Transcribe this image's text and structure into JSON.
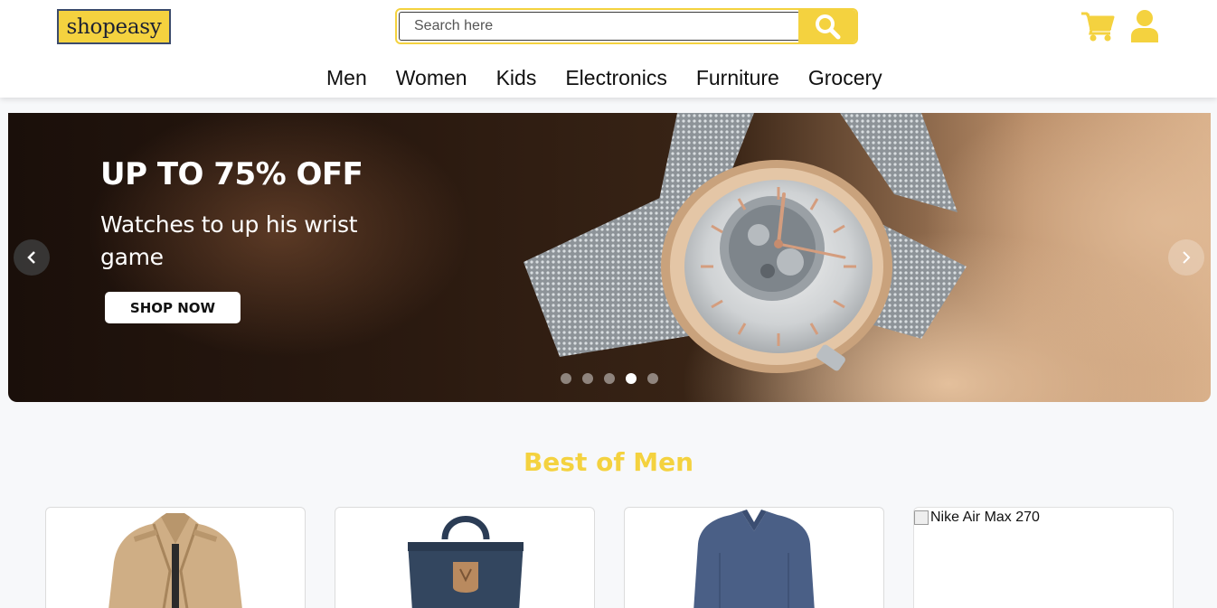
{
  "brand": {
    "logo_text": "shopeasy",
    "accent": "#f4d23f"
  },
  "search": {
    "placeholder": "Search here",
    "value": ""
  },
  "icons": {
    "search": "search-icon",
    "cart": "cart-icon",
    "user": "user-icon"
  },
  "nav": {
    "items": [
      "Men",
      "Women",
      "Kids",
      "Electronics",
      "Furniture",
      "Grocery"
    ]
  },
  "carousel": {
    "heading": "UP TO 75% OFF",
    "subheading": "Watches to up his wrist game",
    "cta": "SHOP NOW",
    "slide_count": 5,
    "active_slide": 4,
    "prev_icon": "chevron-left-icon",
    "next_icon": "chevron-right-icon"
  },
  "section": {
    "title": "Best of Men",
    "products": [
      {
        "name": "jacket",
        "image_kind": "jacket"
      },
      {
        "name": "backpack",
        "image_kind": "backpack"
      },
      {
        "name": "sweater",
        "image_kind": "sweater"
      },
      {
        "name": "nike-air-max",
        "alt": "Nike Air Max 270",
        "image_kind": "broken"
      }
    ]
  }
}
